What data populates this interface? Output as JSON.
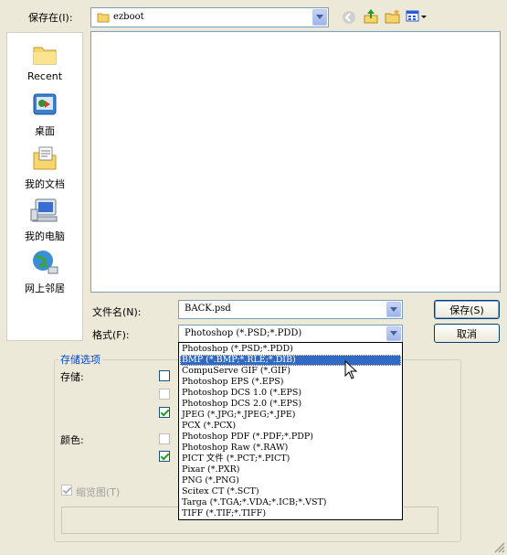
{
  "header": {
    "save_in_label": "保存在(I):",
    "folder_value": "ezboot"
  },
  "toolbar": {
    "back_icon": "back-arrow-icon",
    "up_icon": "up-folder-icon",
    "new_folder_icon": "new-folder-icon",
    "view_menu_icon": "view-menu-icon"
  },
  "places": [
    {
      "label": "Recent",
      "icon": "recent-folder-icon"
    },
    {
      "label": "桌面",
      "icon": "desktop-icon"
    },
    {
      "label": "我的文档",
      "icon": "my-documents-icon"
    },
    {
      "label": "我的电脑",
      "icon": "my-computer-icon"
    },
    {
      "label": "网上邻居",
      "icon": "network-places-icon"
    }
  ],
  "form": {
    "filename_label": "文件名(N):",
    "filename_value": "BACK.psd",
    "format_label": "格式(F):",
    "format_value": "Photoshop (*.PSD;*.PDD)",
    "save_button": "保存(S)",
    "cancel_button": "取消"
  },
  "options": {
    "group_title": "存储选项",
    "storage_label": "存储:",
    "color_label": "颜色:",
    "thumbnail_label": "缩览图(T)"
  },
  "format_options": [
    "Photoshop (*.PSD;*.PDD)",
    "BMP (*.BMP;*.RLE;*.DIB)",
    "CompuServe GIF (*.GIF)",
    "Photoshop EPS (*.EPS)",
    "Photoshop DCS 1.0 (*.EPS)",
    "Photoshop DCS 2.0 (*.EPS)",
    "JPEG (*.JPG;*.JPEG;*.JPE)",
    "PCX (*.PCX)",
    "Photoshop PDF (*.PDF;*.PDP)",
    "Photoshop Raw (*.RAW)",
    "PICT 文件 (*.PCT;*.PICT)",
    "Pixar (*.PXR)",
    "PNG (*.PNG)",
    "Scitex CT (*.SCT)",
    "Targa (*.TGA;*.VDA;*.ICB;*.VST)",
    "TIFF (*.TIF;*.TIFF)"
  ],
  "format_selected_index": 1,
  "colors": {
    "selection": "#316ac5",
    "group_title": "#0046d5",
    "dialog_bg": "#ece9d8"
  }
}
